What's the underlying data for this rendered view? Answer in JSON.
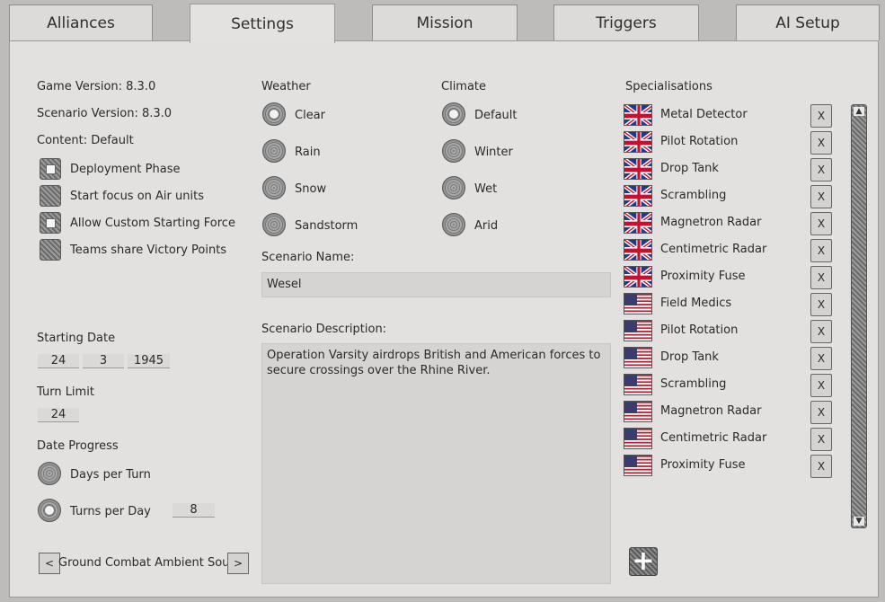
{
  "tabs": [
    {
      "label": "Alliances"
    },
    {
      "label": "Settings"
    },
    {
      "label": "Mission"
    },
    {
      "label": "Triggers"
    },
    {
      "label": "AI Setup"
    }
  ],
  "left": {
    "game_version": "Game Version: 8.3.0",
    "scenario_version": "Scenario Version: 8.3.0",
    "content": "Content: Default",
    "options": [
      {
        "label": "Deployment Phase",
        "checked": true
      },
      {
        "label": "Start focus on Air units",
        "checked": false
      },
      {
        "label": "Allow Custom Starting Force",
        "checked": true
      },
      {
        "label": "Teams share Victory Points",
        "checked": false
      }
    ],
    "starting_date_label": "Starting Date",
    "day": "24",
    "month": "3",
    "year": "1945",
    "turn_limit_label": "Turn Limit",
    "turn_limit": "24",
    "date_progress_label": "Date Progress",
    "days_per_turn_label": "Days per Turn",
    "turns_per_day_label": "Turns per Day",
    "turns_per_day": "8",
    "ambient_sound": "Ground Combat Ambient Sound",
    "prev_symbol": "<",
    "next_symbol": ">"
  },
  "weather": {
    "label": "Weather",
    "options": [
      {
        "label": "Clear",
        "selected": true
      },
      {
        "label": "Rain",
        "selected": false
      },
      {
        "label": "Snow",
        "selected": false
      },
      {
        "label": "Sandstorm",
        "selected": false
      }
    ]
  },
  "climate": {
    "label": "Climate",
    "options": [
      {
        "label": "Default",
        "selected": true
      },
      {
        "label": "Winter",
        "selected": false
      },
      {
        "label": "Wet",
        "selected": false
      },
      {
        "label": "Arid",
        "selected": false
      }
    ]
  },
  "scenario": {
    "name_label": "Scenario Name:",
    "name": "Wesel",
    "description_label": "Scenario Description:",
    "description": "Operation Varsity airdrops British and American forces to secure crossings over the Rhine River."
  },
  "specialisations": {
    "label": "Specialisations",
    "remove_symbol": "X",
    "add_symbol": "+",
    "items": [
      {
        "flag": "uk-flag-icon",
        "name": "Metal Detector"
      },
      {
        "flag": "uk-flag-icon",
        "name": "Pilot Rotation"
      },
      {
        "flag": "uk-flag-icon",
        "name": "Drop Tank"
      },
      {
        "flag": "uk-flag-icon",
        "name": "Scrambling"
      },
      {
        "flag": "uk-flag-icon",
        "name": "Magnetron Radar"
      },
      {
        "flag": "uk-flag-icon",
        "name": "Centimetric Radar"
      },
      {
        "flag": "uk-flag-icon",
        "name": "Proximity Fuse"
      },
      {
        "flag": "us-flag-icon",
        "name": "Field Medics"
      },
      {
        "flag": "us-flag-icon",
        "name": "Pilot Rotation"
      },
      {
        "flag": "us-flag-icon",
        "name": "Drop Tank"
      },
      {
        "flag": "us-flag-icon",
        "name": "Scrambling"
      },
      {
        "flag": "us-flag-icon",
        "name": "Magnetron Radar"
      },
      {
        "flag": "us-flag-icon",
        "name": "Centimetric Radar"
      },
      {
        "flag": "us-flag-icon",
        "name": "Proximity Fuse"
      }
    ]
  },
  "scroll": {
    "up_symbol": "▲",
    "down_symbol": "▼"
  }
}
